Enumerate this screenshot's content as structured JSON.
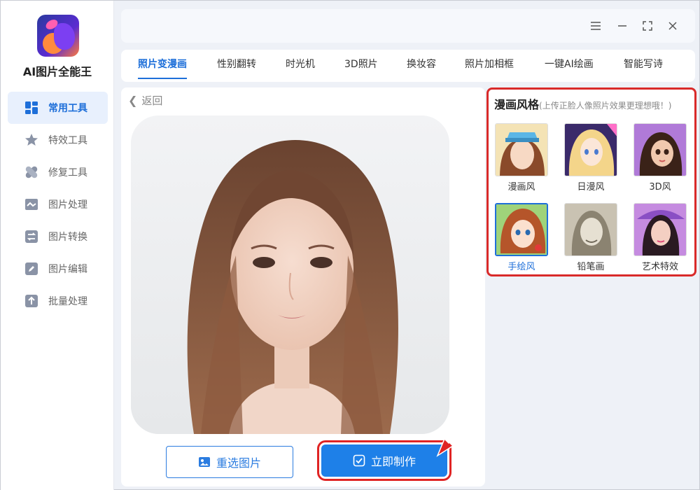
{
  "app": {
    "title": "AI图片全能王"
  },
  "sidebar": {
    "items": [
      {
        "label": "常用工具",
        "icon": "grid-icon",
        "active": true
      },
      {
        "label": "特效工具",
        "icon": "star-icon"
      },
      {
        "label": "修复工具",
        "icon": "bandage-icon"
      },
      {
        "label": "图片处理",
        "icon": "image-wave-icon"
      },
      {
        "label": "图片转换",
        "icon": "swap-icon"
      },
      {
        "label": "图片编辑",
        "icon": "edit-icon"
      },
      {
        "label": "批量处理",
        "icon": "upload-icon"
      }
    ]
  },
  "window_controls": [
    "menu-icon",
    "minimize-icon",
    "fullscreen-icon",
    "close-icon"
  ],
  "tabs": [
    {
      "label": "照片变漫画",
      "active": true
    },
    {
      "label": "性别翻转"
    },
    {
      "label": "时光机"
    },
    {
      "label": "3D照片"
    },
    {
      "label": "换妆容"
    },
    {
      "label": "照片加相框"
    },
    {
      "label": "一键AI绘画"
    },
    {
      "label": "智能写诗"
    }
  ],
  "main": {
    "back_label": "返回",
    "reselect_label": "重选图片",
    "make_label": "立即制作"
  },
  "style_panel": {
    "title": "漫画风格",
    "hint": "(上传正脸人像照片效果更理想哦！)",
    "styles": [
      {
        "label": "漫画风"
      },
      {
        "label": "日漫风"
      },
      {
        "label": "3D风"
      },
      {
        "label": "手绘风",
        "selected": true
      },
      {
        "label": "铅笔画"
      },
      {
        "label": "艺术特效"
      }
    ]
  },
  "colors": {
    "accent": "#1e6fd9",
    "highlight": "#e02424"
  }
}
